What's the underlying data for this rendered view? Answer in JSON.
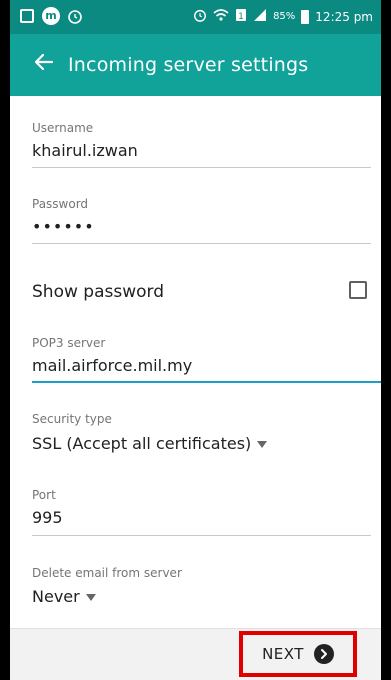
{
  "status_bar": {
    "battery_percent": "85%",
    "time": "12:25 pm"
  },
  "toolbar": {
    "title": "Incoming server settings"
  },
  "fields": {
    "username": {
      "label": "Username",
      "value": "khairul.izwan"
    },
    "password": {
      "label": "Password",
      "value": "••••••"
    },
    "show_password": {
      "label": "Show password",
      "checked": false
    },
    "pop3_server": {
      "label": "POP3 server",
      "value": "mail.airforce.mil.my"
    },
    "security_type": {
      "label": "Security type",
      "value": "SSL (Accept all certificates)"
    },
    "port": {
      "label": "Port",
      "value": "995"
    },
    "delete_email": {
      "label": "Delete email from server",
      "value": "Never"
    }
  },
  "bottom_bar": {
    "next_label": "NEXT"
  },
  "colors": {
    "status_bar": "#0b8a82",
    "toolbar": "#11a29a",
    "focus_underline": "#1aa0c7",
    "highlight_box": "#e10000"
  },
  "icons": [
    "gallery-icon",
    "message-icon",
    "alarm-icon",
    "wifi-icon",
    "sim-icon",
    "signal-icon",
    "battery-icon",
    "back-arrow-icon",
    "checkbox-icon",
    "dropdown-caret-icon",
    "next-arrow-icon"
  ]
}
